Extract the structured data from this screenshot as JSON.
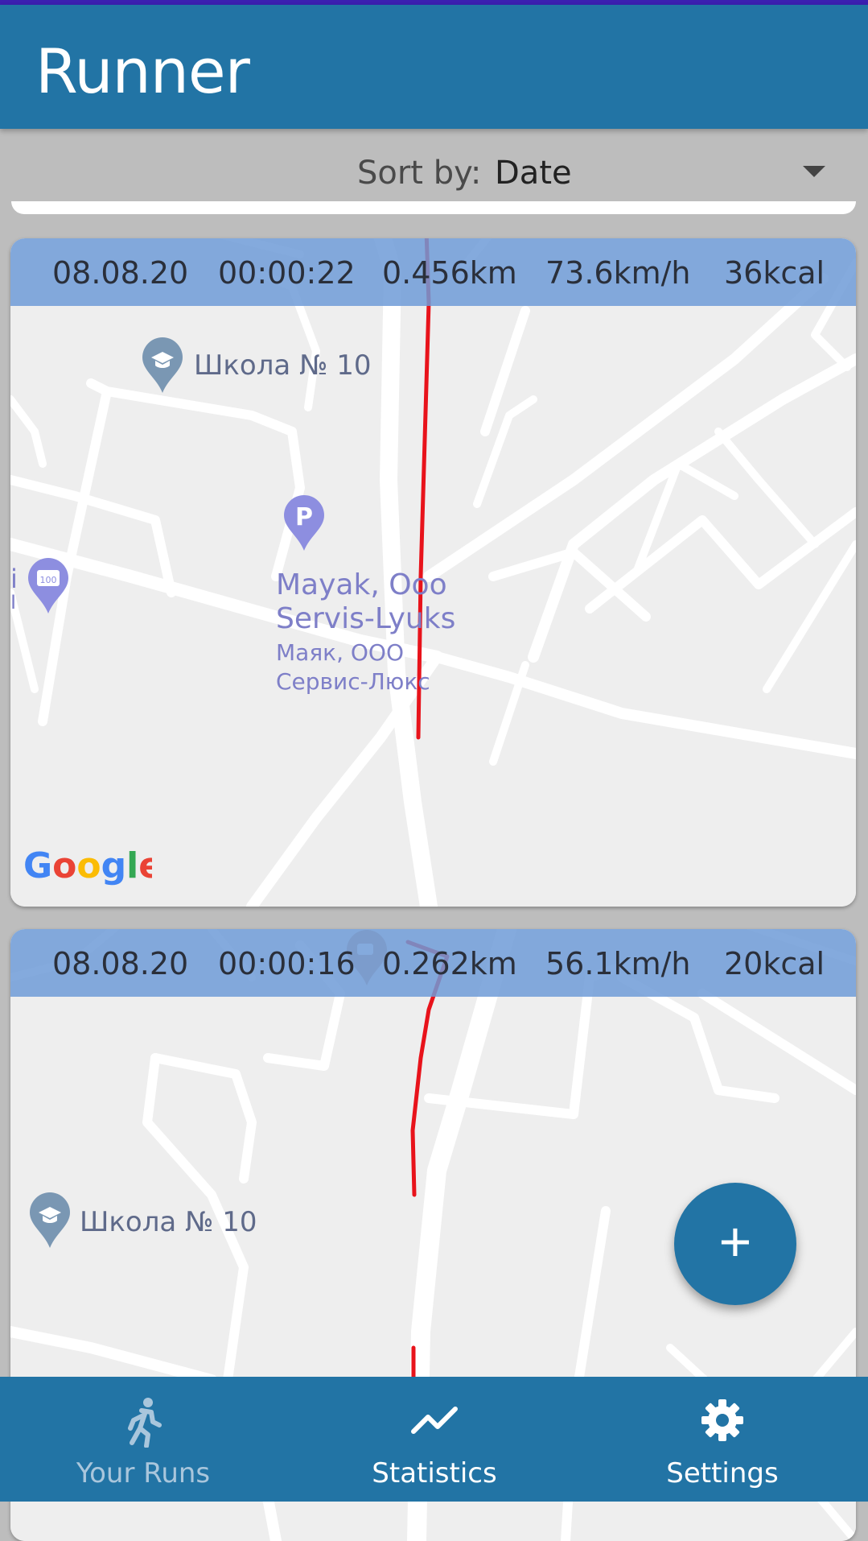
{
  "app": {
    "title": "Runner"
  },
  "sort": {
    "label": "Sort by:",
    "value": "Date"
  },
  "runs": [
    {
      "date": "08.08.20",
      "duration": "00:00:22",
      "distance": "0.456km",
      "speed": "73.6km/h",
      "calories": "36kcal",
      "map_labels": {
        "school": "Школа № 10",
        "poi_en_1": "Mayak, Ooo",
        "poi_en_2": "Servis-Lyuks",
        "poi_ru_1": "Маяк, ООО",
        "poi_ru_2": "Сервис-Люкс",
        "left_edge_1": "i",
        "left_edge_2": "I"
      },
      "attribution": "Google"
    },
    {
      "date": "08.08.20",
      "duration": "00:00:16",
      "distance": "0.262km",
      "speed": "56.1km/h",
      "calories": "20kcal",
      "map_labels": {
        "school": "Школа № 10"
      }
    }
  ],
  "fab": {
    "label": "+"
  },
  "nav": {
    "items": [
      {
        "label": "Your Runs",
        "icon": "runner-icon"
      },
      {
        "label": "Statistics",
        "icon": "trending-icon"
      },
      {
        "label": "Settings",
        "icon": "gear-icon"
      }
    ]
  },
  "colors": {
    "primary": "#2274a5",
    "route": "#e8131b",
    "stats_bar": "#6e9bd7",
    "map_bg": "#eeeeee"
  }
}
